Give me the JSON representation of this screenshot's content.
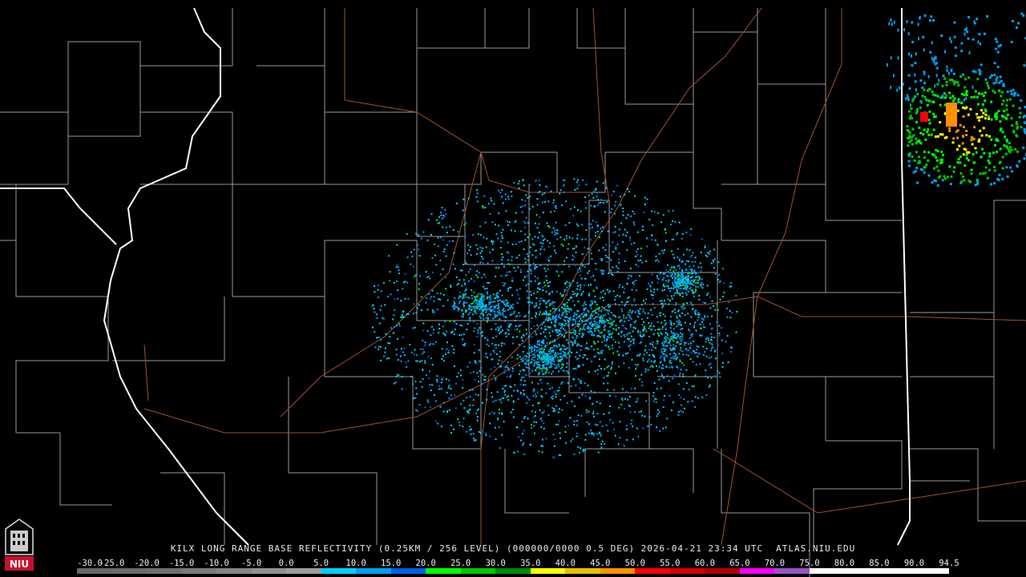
{
  "product": {
    "title": "KILX LONG RANGE BASE REFLECTIVITY (0.25KM / 256 LEVEL) (000000/0000 0.5 DEG) 2026-04-21 23:34 UTC",
    "site": "ATLAS.NIU.EDU"
  },
  "logo": {
    "text": "NIU",
    "color": "#c8102e"
  },
  "color_scale": {
    "labels": [
      "-30.0",
      "-25.0",
      "-20.0",
      "-15.0",
      "-10.0",
      "-5.0",
      "0.0",
      "5.0",
      "10.0",
      "15.0",
      "20.0",
      "25.0",
      "30.0",
      "35.0",
      "40.0",
      "45.0",
      "50.0",
      "55.0",
      "60.0",
      "65.0",
      "70.0",
      "75.0",
      "80.0",
      "85.0",
      "90.0",
      "94.5"
    ],
    "colors": [
      "#666666",
      "#6a6a6a",
      "#707070",
      "#7a7a7a",
      "#858585",
      "#909090",
      "#9c9c9c",
      "#00d0ff",
      "#00a0f0",
      "#0060e0",
      "#00ff00",
      "#00c800",
      "#008c00",
      "#ffff00",
      "#e8c000",
      "#ff9000",
      "#ff0000",
      "#d40000",
      "#b00000",
      "#ff00ff",
      "#9955c9",
      "#ffffff",
      "#ffffff",
      "#ffffff",
      "#ffffff"
    ]
  },
  "map": {
    "state_border_color": "#ffffff",
    "county_border_color": "#9a9a9a",
    "highway_color": "#a0522d",
    "echo_colors": [
      "#00d0ff",
      "#00a0f0",
      "#0060e0",
      "#00ff00",
      "#00c800",
      "#ffff00",
      "#ff9000",
      "#ff0000"
    ]
  }
}
